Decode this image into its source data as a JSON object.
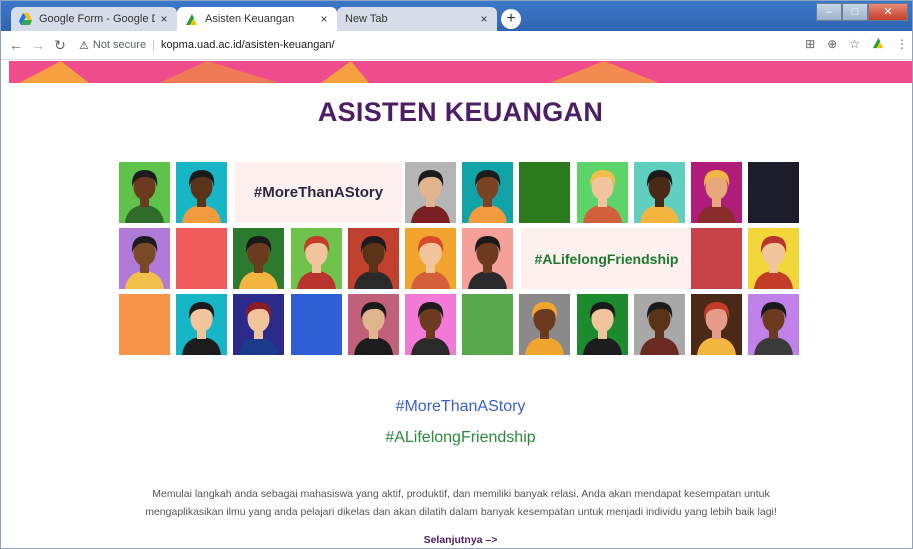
{
  "browser": {
    "tabs": [
      {
        "title": "Google Form - Google Drive",
        "active": false
      },
      {
        "title": "Asisten Keuangan",
        "active": true
      },
      {
        "title": "New Tab",
        "active": false
      }
    ],
    "close_glyph": "×",
    "new_tab_glyph": "+",
    "address": {
      "warning_icon": "⚠",
      "security_label": "Not secure",
      "url": "kopma.uad.ac.id/asisten-keuangan/"
    }
  },
  "page": {
    "title": "ASISTEN KEUANGAN",
    "collage_tags": {
      "first": "#MoreThanAStory",
      "second": "#ALifelongFriendship"
    },
    "hashtag_primary": "#MoreThanAStory",
    "hashtag_secondary": "#ALifelongFriendship",
    "description": "Memulai langkah anda sebagai mahasiswa yang aktif, produktif, dan memiliki banyak relasi. Anda akan mendapat kesempatan untuk mengaplikasikan ilmu yang anda pelajari dikelas dan akan dilatih dalam banyak kesempatan untuk menjadi individu yang lebih baik lagi!",
    "next_link": "Selanjutnya –>"
  },
  "colors": {
    "title": "#4d1d65",
    "banner_pink": "#ee4c8b",
    "hashtag_blue": "#3a5fc8",
    "hashtag_green": "#2a8a3a"
  }
}
